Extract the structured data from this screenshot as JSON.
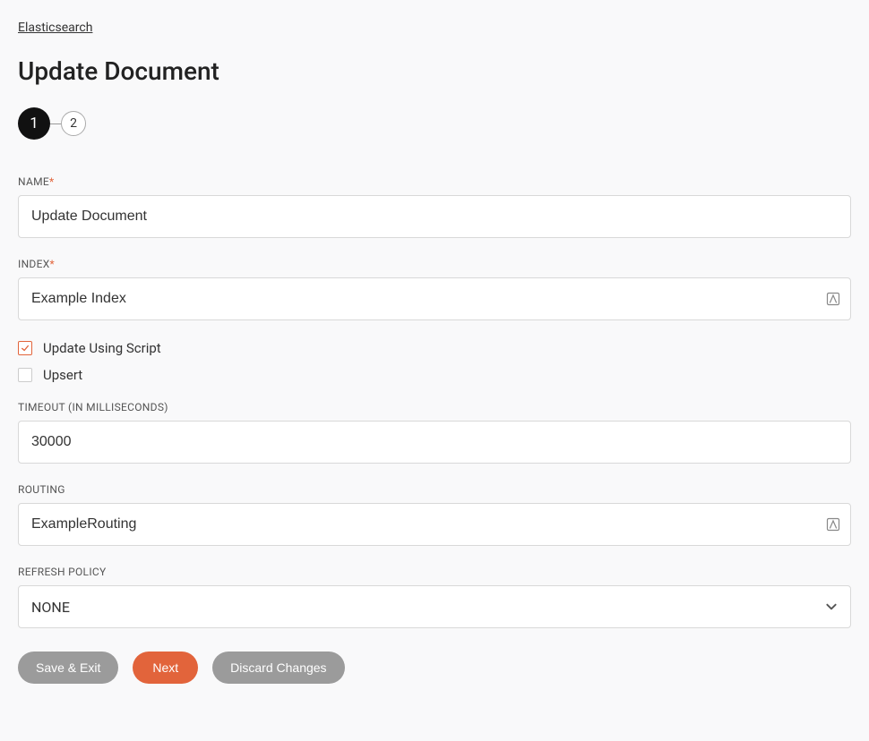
{
  "breadcrumb": "Elasticsearch",
  "page_title": "Update Document",
  "stepper": {
    "steps": [
      "1",
      "2"
    ],
    "active_index": 0
  },
  "fields": {
    "name": {
      "label": "NAME",
      "required": true,
      "value": "Update Document"
    },
    "index": {
      "label": "INDEX",
      "required": true,
      "value": "Example Index",
      "has_var_icon": true
    },
    "update_using_script": {
      "label": "Update Using Script",
      "checked": true
    },
    "upsert": {
      "label": "Upsert",
      "checked": false
    },
    "timeout": {
      "label": "TIMEOUT (IN MILLISECONDS)",
      "required": false,
      "value": "30000"
    },
    "routing": {
      "label": "ROUTING",
      "required": false,
      "value": "ExampleRouting",
      "has_var_icon": true
    },
    "refresh_policy": {
      "label": "REFRESH POLICY",
      "required": false,
      "value": "NONE"
    }
  },
  "buttons": {
    "save_exit": "Save & Exit",
    "next": "Next",
    "discard": "Discard Changes"
  }
}
